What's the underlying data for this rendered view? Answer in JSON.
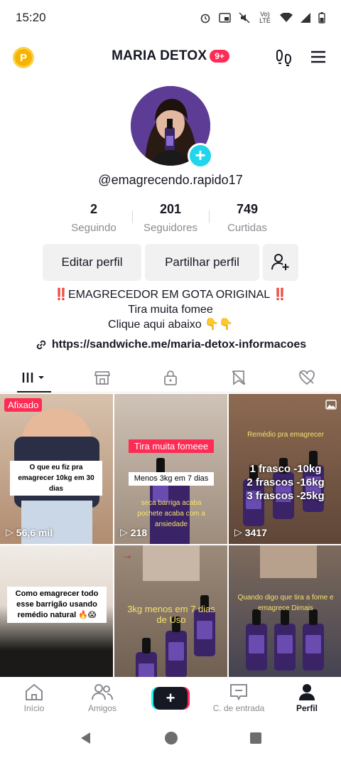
{
  "status_bar": {
    "time": "15:20",
    "network": "Vo) LTE"
  },
  "header": {
    "title": "MARIA DETOX",
    "badge": "9+",
    "coin_label": "P"
  },
  "profile": {
    "username": "@emagrecendo.rapido17",
    "stats": [
      {
        "value": "2",
        "label": "Seguindo"
      },
      {
        "value": "201",
        "label": "Seguidores"
      },
      {
        "value": "749",
        "label": "Curtidas"
      }
    ],
    "buttons": {
      "edit": "Editar perfil",
      "share": "Partilhar perfil"
    },
    "bio": [
      "‼️EMAGRECEDOR EM GOTA ORIGINAL ‼️",
      "Tira muita fomee",
      "Clique aqui abaixo 👇👇"
    ],
    "link": "https://sandwiche.me/maria-detox-informacoes"
  },
  "tabs": [
    "videos-icon",
    "shop-icon",
    "lock-icon",
    "reposts-icon",
    "liked-icon"
  ],
  "grid": [
    {
      "pinned": "Afixado",
      "caption": "O que eu fiz pra emagrecer 10kg em 30 dias",
      "views": "56,6 mil",
      "bg": "#c9a88a"
    },
    {
      "caption": "Tira muita fomeee",
      "caption2": "Menos 3kg em 7 dias",
      "caption3": "seca barriga acaba pochete acaba com a ansiedade",
      "views": "218",
      "bg": "#b9a79a"
    },
    {
      "caption": "Remédio pra emagrecer",
      "caption2": "1 frasco -10kg\n2 frascos -16kg\n3 frascos -25kg",
      "views": "3417",
      "bg": "#7a5a46"
    },
    {
      "caption": "Como emagrecer todo esse barrigão usando remédio natural 🔥😱",
      "views": "",
      "bg": "#2a2420"
    },
    {
      "caption": "3kg menos em 7 dias de Uso",
      "views": "",
      "bg": "#8a7a6a"
    },
    {
      "caption": "Quando digo que tira a fome e emagrece Dimais",
      "views": "",
      "bg": "#6d5c4d"
    }
  ],
  "bottom_nav": [
    {
      "label": "Início",
      "icon": "home-icon"
    },
    {
      "label": "Amigos",
      "icon": "friends-icon"
    },
    {
      "label": "",
      "icon": "create-icon"
    },
    {
      "label": "C. de entrada",
      "icon": "inbox-icon"
    },
    {
      "label": "Perfil",
      "icon": "profile-icon"
    }
  ],
  "colors": {
    "accent": "#fe2c55",
    "cyan": "#20d5ec",
    "text": "#161823",
    "muted": "#8a8b91"
  }
}
